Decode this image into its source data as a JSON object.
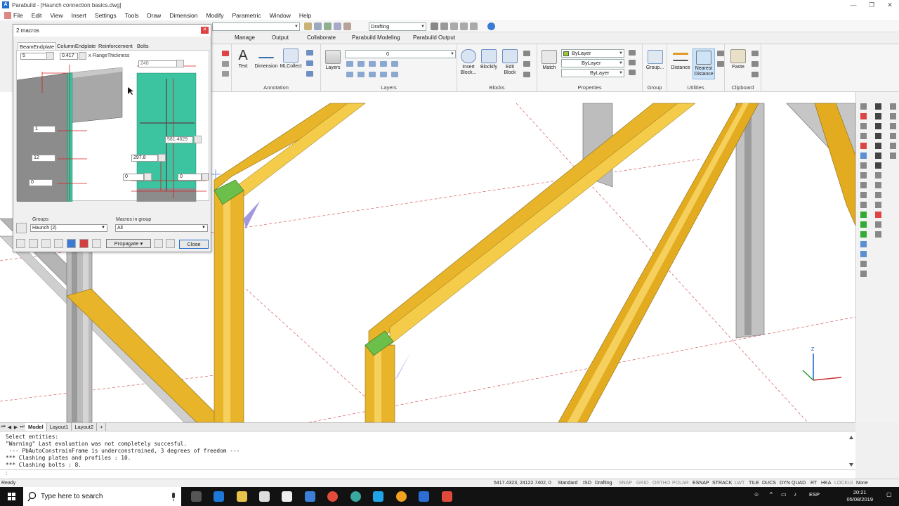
{
  "window": {
    "title": "Parabuild - [Haunch connection basics.dwg]",
    "logo": "A",
    "controls": [
      "—",
      "❐",
      "✕"
    ]
  },
  "menu": [
    "File",
    "Edit",
    "View",
    "Insert",
    "Settings",
    "Tools",
    "Draw",
    "Dimension",
    "Modify",
    "Parametric",
    "Window",
    "Help"
  ],
  "qat": {
    "workspace": "Drafting"
  },
  "ribbon_tabs": [
    "Manage",
    "Output",
    "Collaborate",
    "Parabuild Modeling",
    "Parabuild Output"
  ],
  "ribbon": {
    "annotation": {
      "label": "Annotation",
      "buttons": [
        "Text",
        "Dimension",
        "MLCollect"
      ]
    },
    "layers": {
      "label": "Layers",
      "button": "Layers",
      "current_layer": "0"
    },
    "blocks": {
      "label": "Blocks",
      "buttons": [
        "Insert Block...",
        "Blockify",
        "Edit Block"
      ]
    },
    "properties": {
      "label": "Properties",
      "button": "Match",
      "color": "ByLayer",
      "linetype": "ByLayer",
      "lineweight": "ByLayer"
    },
    "group": {
      "label": "Group",
      "button": "Group..."
    },
    "utilities": {
      "label": "Utilities",
      "buttons": [
        "Distance",
        "Nearest Distance"
      ]
    },
    "clipboard": {
      "label": "Clipboard",
      "button": "Paste"
    }
  },
  "dialog": {
    "title": "2 macros",
    "tabs": [
      "BeamEndplate",
      "ColumnEndplate",
      "Reinforcement",
      "Bolts"
    ],
    "factor_a": "5",
    "factor_b": "0.417",
    "factor_label": "x FlangeThickness",
    "dim_top": "240",
    "dim_width": "581.4629",
    "dim_mid": "297.8",
    "field_1": "1",
    "field_2": "12",
    "field_3": "0",
    "field_4": "0",
    "field_5": "0",
    "groups_label": "Groups",
    "groups_value": "Haunch (2)",
    "macros_label": "Macros in group",
    "macros_value": "All",
    "propagate_label": "Propagate",
    "close_label": "Close"
  },
  "layout_tabs": [
    "Model",
    "Layout1",
    "Layout2",
    "+"
  ],
  "command_history": [
    "Select entities:",
    "\"Warning\" Last evaluation was not completely succesful.",
    " --- PbAutoConstrainFrame is underconstrained, 3 degrees of freedom ---",
    "*** Clashing plates and profiles : 10.",
    "*** Clashing bolts : 8."
  ],
  "command_prompt": ":",
  "status": {
    "ready": "Ready",
    "coords": "5417.4323, 24122.7402, 0",
    "items": [
      "Standard",
      "ISO",
      "Drafting",
      "SNAP",
      "GRID",
      "ORTHO",
      "POLAR",
      "ESNAP",
      "STRACK",
      "LWT",
      "TILE",
      "DUCS",
      "DYN",
      "QUAD",
      "RT",
      "HKA",
      "LOCKUI",
      "None"
    ]
  },
  "taskbar": {
    "search_placeholder": "Type here to search",
    "language": "ESP",
    "time": "20:21",
    "date": "05/08/2019"
  },
  "colors": {
    "beam_yellow": "#f2c23a",
    "plate_green": "#5cb85c",
    "teal": "#3cc3a0",
    "gray_steel": "#a8a8a8",
    "taskbar": "#121212"
  }
}
